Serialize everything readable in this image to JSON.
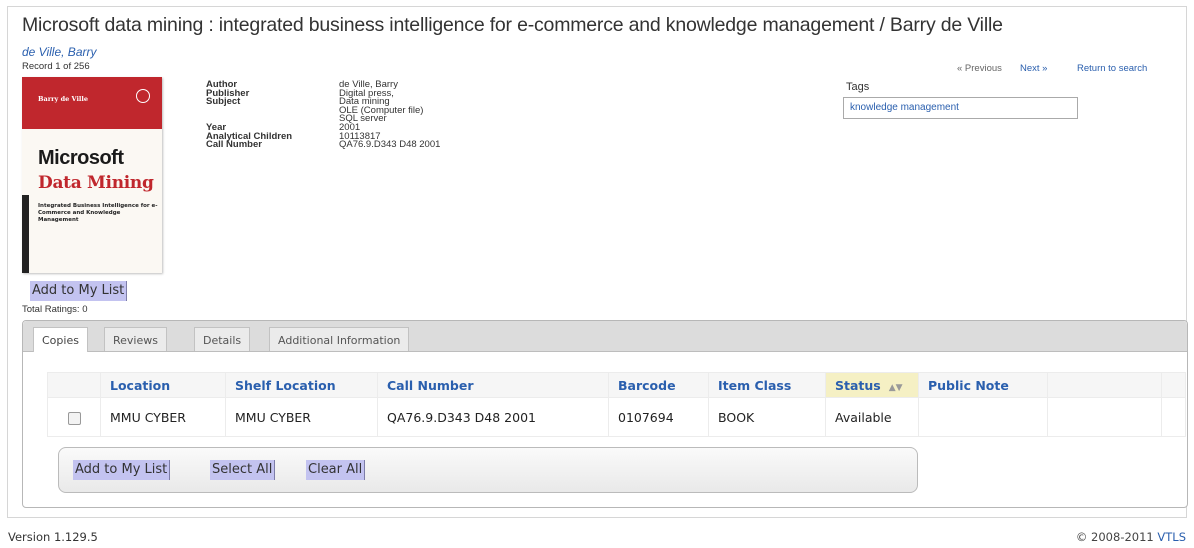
{
  "record": {
    "title": "Microsoft data mining : integrated business intelligence for e-commerce and knowledge management / Barry de Ville",
    "author_link": "de Ville, Barry",
    "record_count": "Record 1 of 256"
  },
  "cover": {
    "author": "Barry de Ville",
    "line1": "Microsoft",
    "line2": "Data Mining",
    "subtitle": "Integrated Business Intelligence for e-Commerce and Knowledge Management"
  },
  "details": {
    "labels": [
      "Author",
      "Publisher",
      "Subject",
      "",
      "",
      "Year",
      "Analytical Children",
      "Call Number"
    ],
    "values": [
      "de Ville, Barry",
      "Digital press,",
      "Data mining",
      "OLE (Computer file)",
      "SQL server",
      "2001",
      "10113817",
      "QA76.9.D343 D48 2001"
    ]
  },
  "nav": {
    "previous": "« Previous",
    "next": "Next »",
    "return": "Return to search"
  },
  "tags": {
    "label": "Tags",
    "value": "knowledge management"
  },
  "actions": {
    "add_to_list": "Add to My List",
    "select_all": "Select All",
    "clear_all": "Clear All"
  },
  "ratings": "Total Ratings: 0",
  "tabs": [
    "Copies",
    "Reviews",
    "Details",
    "Additional Information"
  ],
  "table": {
    "headers": [
      "Location",
      "Shelf Location",
      "Call Number",
      "Barcode",
      "Item Class",
      "Status",
      "Public Note"
    ],
    "rows": [
      [
        "MMU CYBER",
        "MMU CYBER",
        "QA76.9.D343 D48 2001",
        "0107694",
        "BOOK",
        "Available",
        ""
      ]
    ]
  },
  "footer": {
    "version": "Version 1.129.5",
    "copyright": "© 2008-2011 ",
    "vendor": "VTLS"
  },
  "colors": {
    "link": "#2a5fae",
    "button_highlight": "#c3c3f0",
    "status_header": "#f5f0c4",
    "cover_red": "#c0272d"
  }
}
